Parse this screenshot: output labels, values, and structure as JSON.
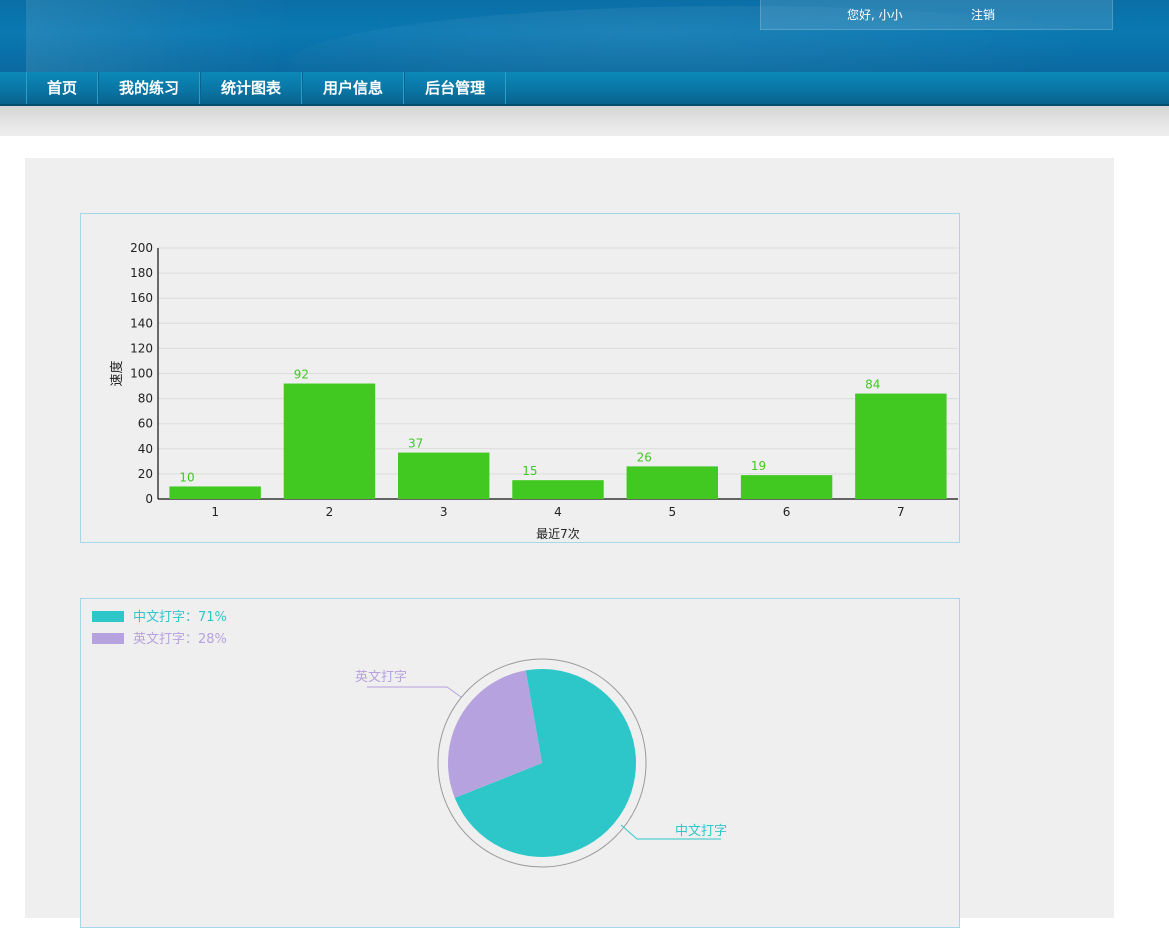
{
  "header": {
    "greeting": "您好, 小小",
    "logout_label": "注销"
  },
  "nav": {
    "items": [
      "首页",
      "我的练习",
      "统计图表",
      "用户信息",
      "后台管理"
    ]
  },
  "colors": {
    "bar": "#41c922",
    "bar_label": "#41c922",
    "pie_chinese": "#2ec7c9",
    "pie_english": "#b6a2de",
    "panel_border": "#a6d6ec"
  },
  "chart_data": [
    {
      "type": "bar",
      "categories": [
        "1",
        "2",
        "3",
        "4",
        "5",
        "6",
        "7"
      ],
      "values": [
        10,
        92,
        37,
        15,
        26,
        19,
        84
      ],
      "xlabel": "最近7次",
      "ylabel": "速度",
      "ylim": [
        0,
        200
      ],
      "yticks": [
        0,
        20,
        40,
        60,
        80,
        100,
        120,
        140,
        160,
        180,
        200
      ],
      "grid": true
    },
    {
      "type": "pie",
      "legend": [
        {
          "name": "中文打字",
          "text": "中文打字：71%"
        },
        {
          "name": "英文打字",
          "text": "英文打字：28%"
        }
      ],
      "slices": [
        {
          "name": "中文打字",
          "value": 71
        },
        {
          "name": "英文打字",
          "value": 28
        }
      ],
      "legend_position": "top-left"
    }
  ]
}
